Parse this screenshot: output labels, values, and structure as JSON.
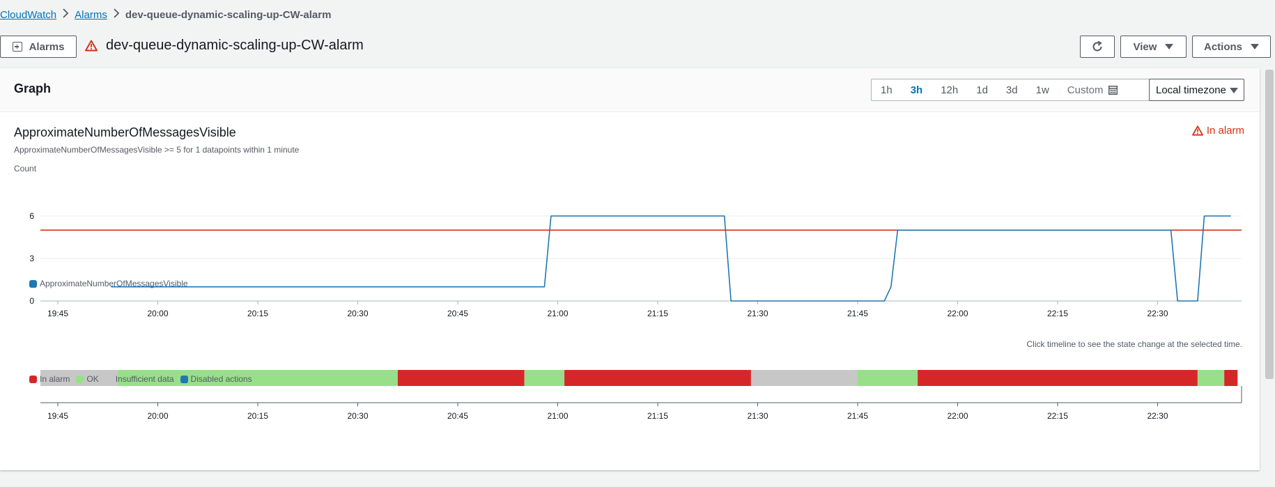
{
  "breadcrumb": {
    "items": [
      "CloudWatch",
      "Alarms"
    ],
    "current": "dev-queue-dynamic-scaling-up-CW-alarm"
  },
  "header": {
    "alarms_button": "Alarms",
    "title": "dev-queue-dynamic-scaling-up-CW-alarm",
    "view_button": "View",
    "actions_button": "Actions"
  },
  "graph_panel": {
    "title": "Graph",
    "ranges": [
      "1h",
      "3h",
      "12h",
      "1d",
      "3d",
      "1w"
    ],
    "active_range": "3h",
    "custom_label": "Custom",
    "timezone": "Local timezone",
    "metric_title": "ApproximateNumberOfMessagesVisible",
    "metric_desc": "ApproximateNumberOfMessagesVisible >= 5 for 1 datapoints within 1 minute",
    "state": "In alarm",
    "legend_series": "ApproximateNumberOfMessagesVisible",
    "timeline_hint": "Click timeline to see the state change at the selected time.",
    "state_legend": [
      {
        "label": "In alarm",
        "color": "#d62728"
      },
      {
        "label": "OK",
        "color": "#98df8a"
      },
      {
        "label": "Insufficient data",
        "color": "#c7c7c7"
      },
      {
        "label": "Disabled actions",
        "color": "#1f77b4"
      }
    ]
  },
  "chart_data": [
    {
      "type": "line",
      "ylabel": "Count",
      "ylim": [
        0,
        6
      ],
      "yticks": [
        0,
        3,
        6
      ],
      "xticks": [
        "19:45",
        "20:00",
        "20:15",
        "20:30",
        "20:45",
        "21:00",
        "21:15",
        "21:30",
        "21:45",
        "22:00",
        "22:15",
        "22:30"
      ],
      "threshold": 5,
      "threshold_color": "#d13212",
      "series": [
        {
          "name": "ApproximateNumberOfMessagesVisible",
          "color": "#1f77b4",
          "points": [
            [
              "19:53",
              1
            ],
            [
              "20:58",
              1
            ],
            [
              "20:59",
              6
            ],
            [
              "21:25",
              6
            ],
            [
              "21:26",
              0
            ],
            [
              "21:49",
              0
            ],
            [
              "21:50",
              1
            ],
            [
              "21:51",
              5
            ],
            [
              "22:32",
              5
            ],
            [
              "22:33",
              0
            ],
            [
              "22:36",
              0
            ],
            [
              "22:37",
              6
            ],
            [
              "22:41",
              6
            ]
          ]
        }
      ]
    },
    {
      "type": "timeline",
      "xticks": [
        "19:45",
        "20:00",
        "20:15",
        "20:30",
        "20:45",
        "21:00",
        "21:15",
        "21:30",
        "21:45",
        "22:00",
        "22:15",
        "22:30"
      ],
      "segments": [
        {
          "start": "19:42",
          "end": "19:54",
          "state": "Insufficient data"
        },
        {
          "start": "19:54",
          "end": "20:36",
          "state": "OK"
        },
        {
          "start": "20:36",
          "end": "20:55",
          "state": "In alarm"
        },
        {
          "start": "20:55",
          "end": "21:01",
          "state": "OK"
        },
        {
          "start": "21:01",
          "end": "21:29",
          "state": "In alarm"
        },
        {
          "start": "21:29",
          "end": "21:45",
          "state": "Insufficient data"
        },
        {
          "start": "21:45",
          "end": "21:54",
          "state": "OK"
        },
        {
          "start": "21:54",
          "end": "22:36",
          "state": "In alarm"
        },
        {
          "start": "22:36",
          "end": "22:40",
          "state": "OK"
        },
        {
          "start": "22:40",
          "end": "22:42",
          "state": "In alarm"
        }
      ]
    }
  ]
}
